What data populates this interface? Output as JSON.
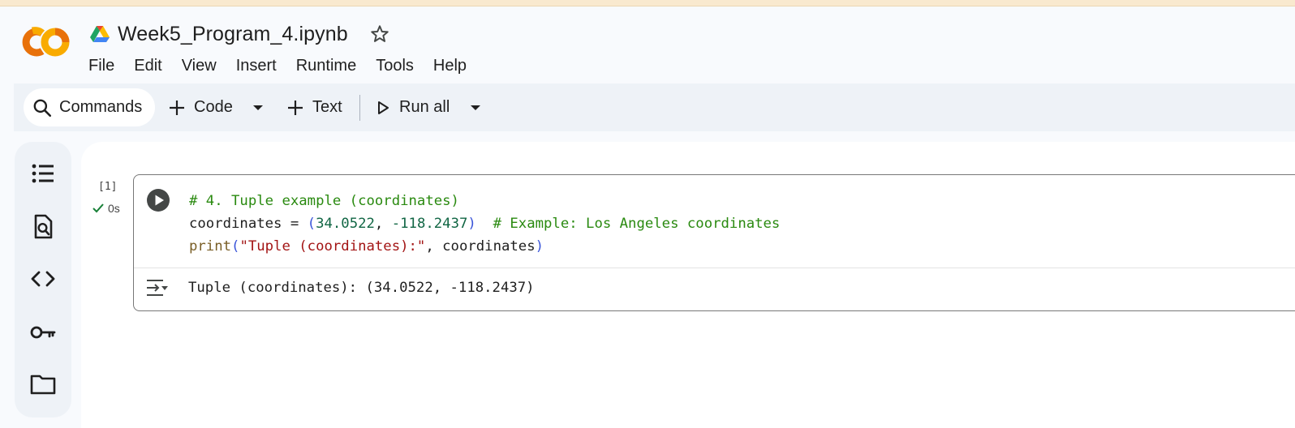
{
  "app": {
    "title": "Week5_Program_4.ipynb",
    "logo": "colab-logo",
    "accent_orange": "#f9ab00",
    "accent_dark_orange": "#e8710a"
  },
  "menu": [
    "File",
    "Edit",
    "View",
    "Insert",
    "Runtime",
    "Tools",
    "Help"
  ],
  "toolbar": {
    "commands_label": "Commands",
    "code_label": "Code",
    "text_label": "Text",
    "run_all_label": "Run all"
  },
  "sidebar": {
    "icons": [
      "table-of-contents-icon",
      "find-icon",
      "code-snippets-icon",
      "secrets-key-icon",
      "files-folder-icon"
    ]
  },
  "cell": {
    "execution_count": "[1]",
    "status_time": "0s",
    "code": {
      "line1_comment": "# 4. Tuple example (coordinates)",
      "line2_var": "coordinates = ",
      "line2_open": "(",
      "line2_num1": "34.0522",
      "line2_comma": ", ",
      "line2_num2": "-118.2437",
      "line2_close": ")",
      "line2_comment": "# Example: Los Angeles coordinates",
      "line3_fn": "print",
      "line3_open": "(",
      "line3_str": "\"Tuple (coordinates):\"",
      "line3_rest": ", coordinates",
      "line3_close": ")"
    },
    "output": "Tuple (coordinates): (34.0522, -118.2437)"
  }
}
